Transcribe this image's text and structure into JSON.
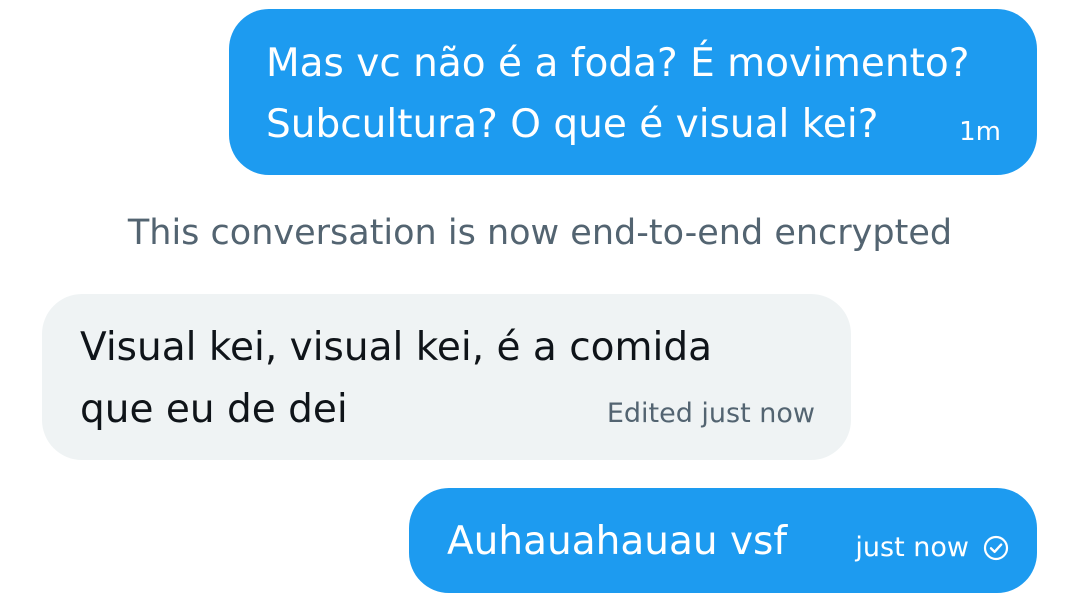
{
  "messages": [
    {
      "direction": "outgoing",
      "lines": [
        "Mas vc não é a foda? É movimento?",
        "Subcultura? O que é visual kei?"
      ],
      "time": "1m"
    },
    {
      "direction": "incoming",
      "lines": [
        "Visual kei, visual kei, é a comida",
        "que eu de dei"
      ],
      "time": "Edited just now"
    },
    {
      "direction": "outgoing",
      "lines": [
        "Auhauahauau vsf"
      ],
      "time": "just now",
      "status_icon": "sent-check-icon"
    }
  ],
  "system_notice": "This conversation is now end-to-end encrypted",
  "colors": {
    "outgoing_bubble": "#1d9bf0",
    "incoming_bubble": "#eff3f4",
    "system_text": "#536471"
  }
}
